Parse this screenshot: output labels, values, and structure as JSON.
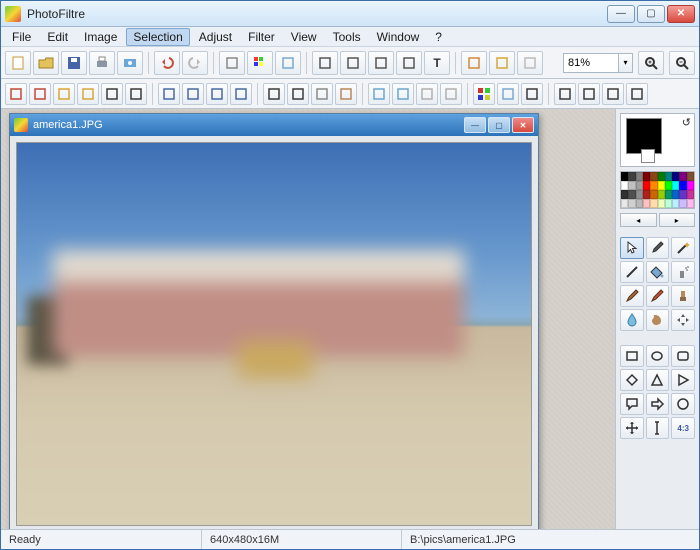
{
  "window_title": "PhotoFiltre",
  "menu": [
    "File",
    "Edit",
    "Image",
    "Selection",
    "Adjust",
    "Filter",
    "View",
    "Tools",
    "Window",
    "?"
  ],
  "menu_selected_index": 3,
  "zoom": "81%",
  "document": {
    "title": "america1.JPG",
    "path": "B:\\pics\\america1.JPG",
    "size_text": "640x480x16M"
  },
  "status": {
    "ready": "Ready"
  },
  "toolbar1": [
    {
      "name": "new-file-icon",
      "color": "#fff",
      "border": "#c59a3a"
    },
    {
      "name": "open-icon",
      "color": "#e2c25a"
    },
    {
      "name": "save-icon",
      "color": "#4565a8"
    },
    {
      "name": "print-icon",
      "color": "#8a95a2"
    },
    {
      "name": "twain-icon",
      "color": "#6aa6d6"
    },
    {
      "name": "sep"
    },
    {
      "name": "undo-icon",
      "color": "#c84d3a"
    },
    {
      "name": "redo-icon",
      "color": "#b8b8b8"
    },
    {
      "name": "sep"
    },
    {
      "name": "layer-icon",
      "color": "#888"
    },
    {
      "name": "rgb-icon"
    },
    {
      "name": "image-manager-icon",
      "color": "#7aa8d2"
    },
    {
      "name": "sep"
    },
    {
      "name": "arrow-down-icon",
      "color": "#555"
    },
    {
      "name": "effects-icon",
      "color": "#555"
    },
    {
      "name": "clone-icon",
      "color": "#555"
    },
    {
      "name": "transparent-icon",
      "color": "#555"
    },
    {
      "name": "text-icon",
      "color": "#333"
    },
    {
      "name": "sep"
    },
    {
      "name": "plugin-a-icon",
      "color": "#d28a3a"
    },
    {
      "name": "plugin-b-icon",
      "color": "#d2a83a"
    },
    {
      "name": "plugin-c-icon",
      "color": "#bbb"
    }
  ],
  "toolbar2": [
    {
      "name": "auto-levels-icon",
      "c": "#c04a3a"
    },
    {
      "name": "auto-contrast-icon",
      "c": "#c04a3a"
    },
    {
      "name": "brightness-minus-icon",
      "c": "#d6a838"
    },
    {
      "name": "brightness-plus-icon",
      "c": "#d6a838"
    },
    {
      "name": "contrast-minus-icon",
      "c": "#3a3a3a"
    },
    {
      "name": "contrast-plus-icon",
      "c": "#3a3a3a"
    },
    {
      "name": "sep"
    },
    {
      "name": "gamma-minus-icon",
      "c": "#4a68a6"
    },
    {
      "name": "gamma-plus-icon",
      "c": "#4a68a6"
    },
    {
      "name": "sat-minus-icon",
      "c": "#4a68a6"
    },
    {
      "name": "sat-plus-icon",
      "c": "#4a68a6"
    },
    {
      "name": "sep"
    },
    {
      "name": "histogram-icon",
      "c": "#3a3a3a"
    },
    {
      "name": "equalize-icon",
      "c": "#3a3a3a"
    },
    {
      "name": "grayscale-icon",
      "c": "#8a8a8a"
    },
    {
      "name": "sepia-icon",
      "c": "#b88a5a"
    },
    {
      "name": "sep"
    },
    {
      "name": "blur-icon",
      "c": "#6aa6d0"
    },
    {
      "name": "sharpen-icon",
      "c": "#6aa6d0"
    },
    {
      "name": "filter-a-icon",
      "c": "#b0b0b0"
    },
    {
      "name": "filter-b-icon",
      "c": "#b0b0b0"
    },
    {
      "name": "sep"
    },
    {
      "name": "variations-icon"
    },
    {
      "name": "gradient-icon",
      "c": "#7aa8d2"
    },
    {
      "name": "crop-icon",
      "c": "#3a3a3a"
    },
    {
      "name": "sep"
    },
    {
      "name": "mirror-h-icon",
      "c": "#3a3a3a"
    },
    {
      "name": "mirror-v-icon",
      "c": "#3a3a3a"
    },
    {
      "name": "rotate-l-icon",
      "c": "#3a3a3a"
    },
    {
      "name": "rotate-r-icon",
      "c": "#3a3a3a"
    }
  ],
  "palette": [
    "#000000",
    "#404040",
    "#808080",
    "#800000",
    "#8b4513",
    "#008000",
    "#008080",
    "#000080",
    "#800080",
    "#805030",
    "#ffffff",
    "#c0c0c0",
    "#a0a0a0",
    "#ff0000",
    "#ff8800",
    "#ffff00",
    "#00ff00",
    "#00ffff",
    "#0000ff",
    "#ff00ff",
    "#303030",
    "#505050",
    "#909090",
    "#b02020",
    "#cc6600",
    "#99cc00",
    "#009966",
    "#0066cc",
    "#6633cc",
    "#cc3399",
    "#e8e8e8",
    "#d0d0d0",
    "#b8b8b8",
    "#ffc0c0",
    "#ffddaa",
    "#eeffbb",
    "#bbffdd",
    "#bbeeff",
    "#ccbbff",
    "#ffbbee"
  ],
  "fg_color": "#000000",
  "bg_color": "#ffffff",
  "tool_group_1": [
    {
      "name": "pointer-icon",
      "sel": true
    },
    {
      "name": "pipette-icon"
    },
    {
      "name": "wand-icon"
    },
    {
      "name": "line-icon"
    },
    {
      "name": "fill-icon"
    },
    {
      "name": "spray-icon"
    },
    {
      "name": "brush-icon"
    },
    {
      "name": "advanced-brush-icon"
    },
    {
      "name": "stamp-icon"
    },
    {
      "name": "blur-tool-icon"
    },
    {
      "name": "smudge-icon"
    },
    {
      "name": "scroll-icon"
    }
  ],
  "tool_group_2": [
    {
      "name": "rect-icon"
    },
    {
      "name": "ellipse-icon"
    },
    {
      "name": "rounded-rect-icon"
    },
    {
      "name": "diamond-icon"
    },
    {
      "name": "triangle-icon"
    },
    {
      "name": "triangle-right-icon"
    },
    {
      "name": "talk-bubble-icon"
    },
    {
      "name": "arrow-shape-icon"
    },
    {
      "name": "circle-shape-icon"
    },
    {
      "name": "move-icon"
    },
    {
      "name": "text-cursor-icon"
    },
    {
      "name": "ratio-43-icon",
      "label": "4:3"
    }
  ]
}
